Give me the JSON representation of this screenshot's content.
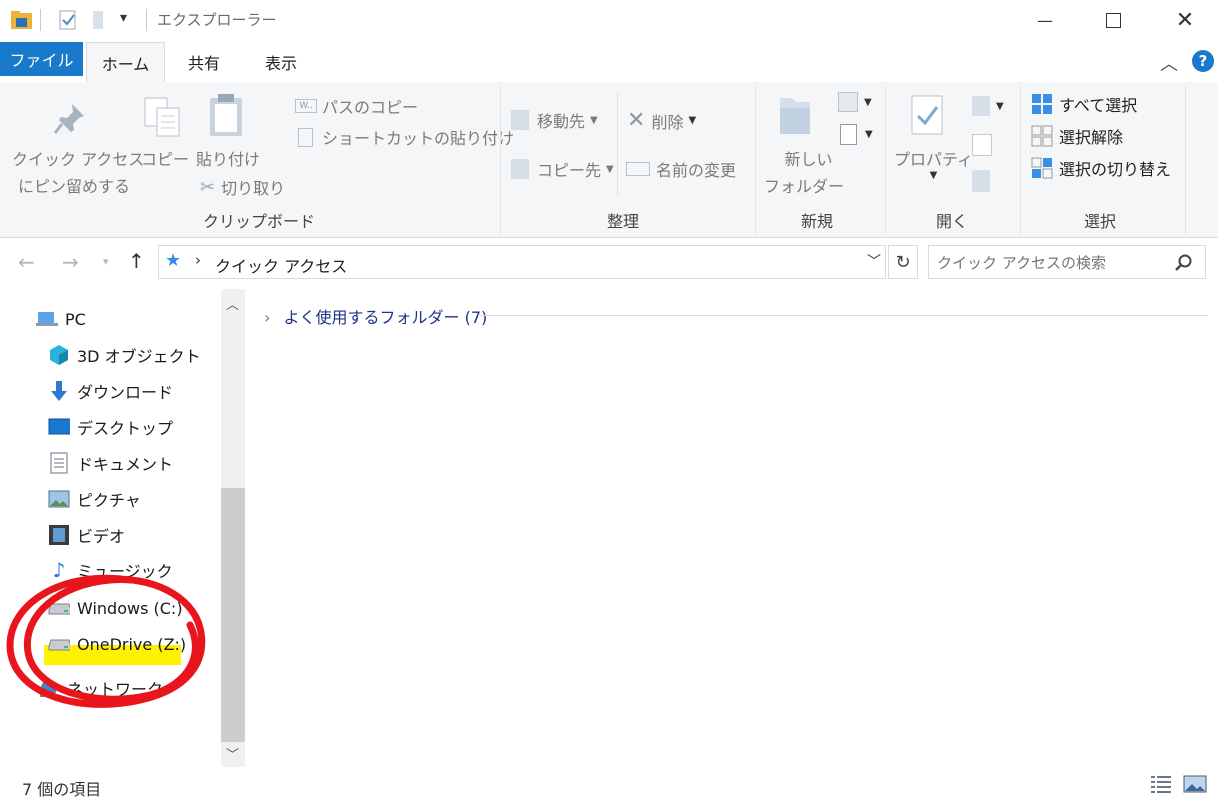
{
  "window": {
    "title": "エクスプローラー"
  },
  "tabs": {
    "file": "ファイル",
    "home": "ホーム",
    "share": "共有",
    "view": "表示"
  },
  "ribbon": {
    "clipboard": {
      "pin_line1": "クイック アクセス",
      "pin_line2": "にピン留めする",
      "copy": "コピー",
      "paste": "貼り付け",
      "copy_path": "パスのコピー",
      "paste_shortcut": "ショートカットの貼り付け",
      "cut": "切り取り",
      "group": "クリップボード"
    },
    "organize": {
      "move_to": "移動先",
      "copy_to": "コピー先",
      "delete": "削除",
      "rename": "名前の変更",
      "group": "整理"
    },
    "new": {
      "new_folder_line1": "新しい",
      "new_folder_line2": "フォルダー",
      "group": "新規"
    },
    "open": {
      "properties": "プロパティ",
      "group": "開く"
    },
    "select": {
      "select_all": "すべて選択",
      "select_none": "選択解除",
      "invert": "選択の切り替え",
      "group": "選択"
    }
  },
  "address": {
    "path": "クイック アクセス",
    "search_placeholder": "クイック アクセスの検索"
  },
  "sidebar": {
    "items": [
      {
        "label": "PC",
        "icon": "pc-icon"
      },
      {
        "label": "3D オブジェクト",
        "icon": "cube-icon"
      },
      {
        "label": "ダウンロード",
        "icon": "download-icon"
      },
      {
        "label": "デスクトップ",
        "icon": "desktop-icon"
      },
      {
        "label": "ドキュメント",
        "icon": "document-icon"
      },
      {
        "label": "ピクチャ",
        "icon": "picture-icon"
      },
      {
        "label": "ビデオ",
        "icon": "video-icon"
      },
      {
        "label": "ミュージック",
        "icon": "music-icon"
      },
      {
        "label": "Windows (C:)",
        "icon": "drive-icon"
      },
      {
        "label": "OneDrive (Z:)",
        "icon": "drive-icon"
      },
      {
        "label": "ネットワーク",
        "icon": "network-icon"
      }
    ]
  },
  "main": {
    "group_header": "よく使用するフォルダー (7)"
  },
  "status": {
    "item_count": "7 個の項目"
  },
  "colors": {
    "accent": "#1979ca",
    "annotation_red": "#e8161c",
    "highlight_yellow": "#fff200"
  }
}
